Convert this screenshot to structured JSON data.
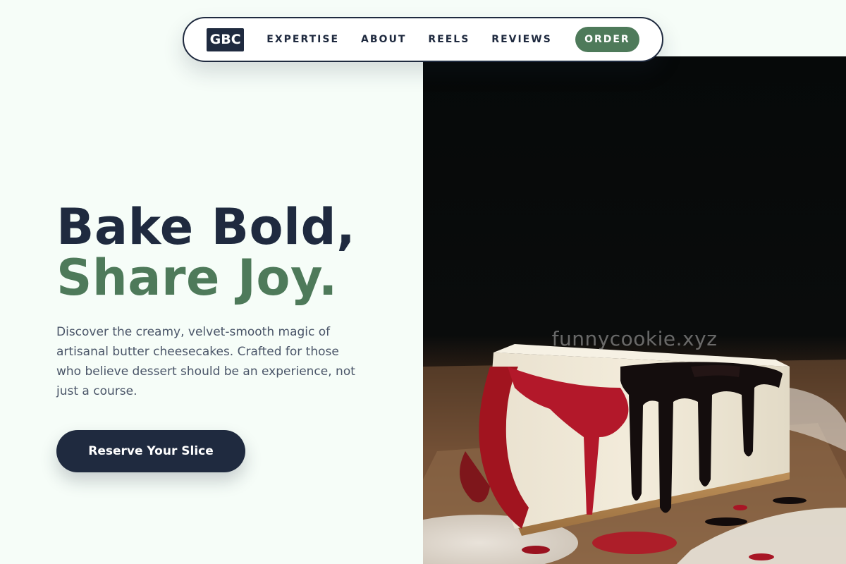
{
  "nav": {
    "logo": "GBC",
    "links": [
      {
        "label": "EXPERTISE"
      },
      {
        "label": "ABOUT"
      },
      {
        "label": "REELS"
      },
      {
        "label": "REVIEWS"
      }
    ],
    "order_label": "ORDER"
  },
  "hero": {
    "headline_line1": "Bake Bold,",
    "headline_line2": "Share Joy.",
    "description": "Discover the creamy, velvet-smooth magic of artisanal butter cheesecakes. Crafted for those who believe dessert should be an experience, not just a course.",
    "cta_label": "Reserve Your Slice"
  },
  "image": {
    "watermark": "funnycookie.xyz"
  },
  "colors": {
    "navy": "#1f2a3f",
    "green": "#4e7a5a",
    "background": "#f6fdf8",
    "body_text": "#4a5568"
  }
}
